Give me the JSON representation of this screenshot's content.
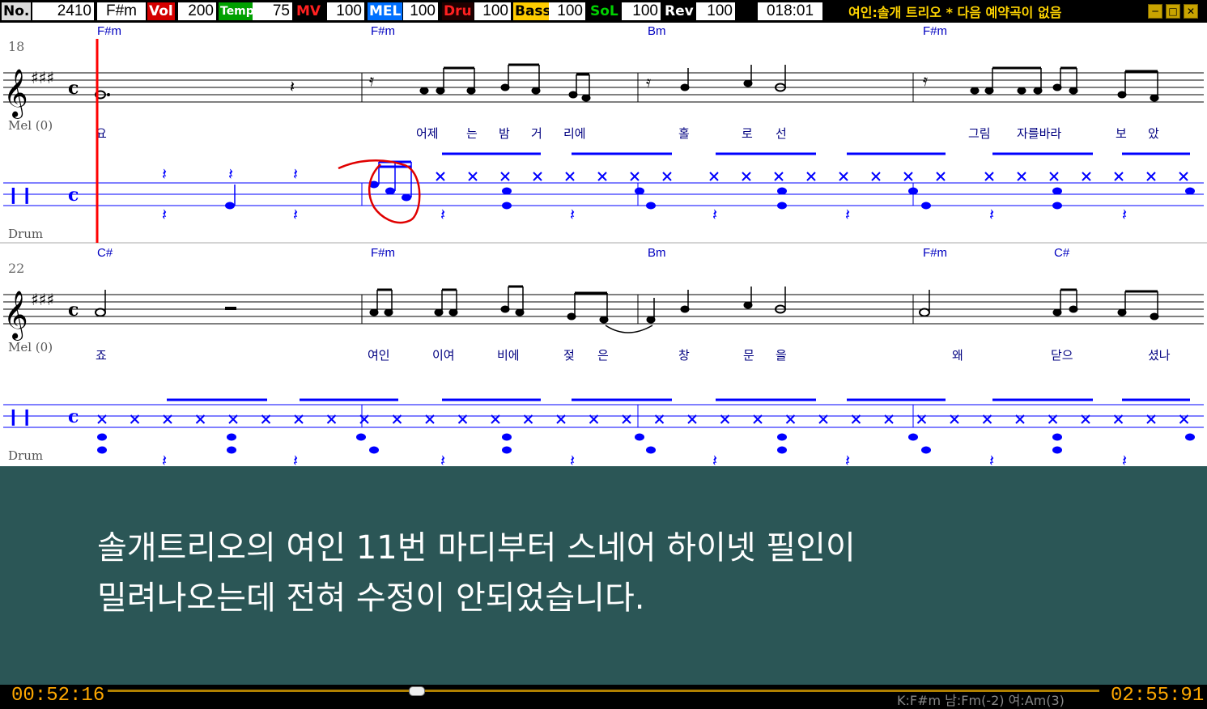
{
  "topbar": {
    "no_label": "No.",
    "no_value": "2410",
    "key": "F#m",
    "vol_label": "Vol",
    "vol_value": "200",
    "temp_label": "Temp",
    "temp_value": "75",
    "mv_label": "MV",
    "mv_value": "100",
    "mel_label": "MEL",
    "mel_value": "100",
    "dru_label": "Dru",
    "dru_value": "100",
    "bass_label": "Bass",
    "bass_value": "100",
    "sol_label": "SoL",
    "sol_value": "100",
    "rev_label": "Rev",
    "rev_value": "100",
    "counter": "018:01",
    "now_playing": "여인:솔개 트리오 * 다음 예약곡이 없음",
    "colors": {
      "vol": "#d40000",
      "temp": "#00a000",
      "mv": "#e00000",
      "mel": "#0070ff",
      "dru": "#e00000",
      "bass": "#ffcc00",
      "sol": "#00c000",
      "rev": "#ffffff"
    }
  },
  "window_controls": {
    "minimize": "minimize-icon",
    "maximize": "maximize-icon",
    "close": "close-icon"
  },
  "score": {
    "system1": {
      "measure_number": "18",
      "chords": [
        "F#m",
        "F#m",
        "Bm",
        "F#m"
      ],
      "melody_label": "Mel (0)",
      "drum_label": "Drum",
      "lyrics": [
        "요",
        "어제",
        "는",
        "밤",
        "거",
        "리에",
        "홀",
        "로",
        "선",
        "그림",
        "자를바라",
        "보",
        "았"
      ]
    },
    "system2": {
      "measure_number": "22",
      "chords": [
        "C#",
        "F#m",
        "Bm",
        "F#m",
        "C#"
      ],
      "melody_label": "Mel (0)",
      "drum_label": "Drum",
      "lyrics": [
        "죠",
        "여인",
        "이여",
        "비에",
        "젖",
        "은",
        "창",
        "문",
        "을",
        "왜",
        "닫으",
        "셨나"
      ]
    },
    "colors": {
      "drum_notes": "#0000ff",
      "lyrics": "#000080",
      "playhead": "#ff0000",
      "annotation": "#e00000"
    }
  },
  "caption": {
    "line1": "솔개트리오의 여인 11번 마디부터 스네어 하이넷 필인이",
    "line2": "밀려나오는데 전혀 수정이 안되었습니다."
  },
  "bottombar": {
    "elapsed": "00:52:16",
    "key_info": "K:F#m 남:Fm(-2) 여:Am(3)",
    "total": "02:55:91",
    "progress": 0.3
  }
}
